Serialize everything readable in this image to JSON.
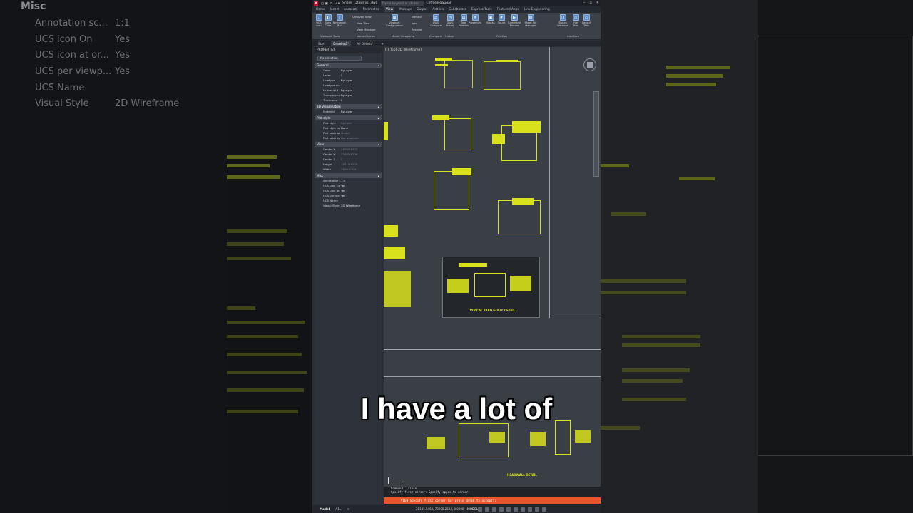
{
  "background_left": {
    "heading": "Misc",
    "rows": [
      {
        "key": "Annotation sc...",
        "value": "1:1"
      },
      {
        "key": "UCS icon On",
        "value": "Yes"
      },
      {
        "key": "UCS icon at or...",
        "value": "Yes"
      },
      {
        "key": "UCS per viewp...",
        "value": "Yes"
      },
      {
        "key": "UCS Name",
        "value": ""
      },
      {
        "key": "Visual Style",
        "value": "2D Wireframe"
      }
    ]
  },
  "titlebar": {
    "share": "Share",
    "file": "Drawing1.dwg",
    "search_placeholder": "Type a keyword or phrase",
    "user": "CoffeeTeaSugar"
  },
  "ribbon_tabs": [
    "Home",
    "Insert",
    "Annotate",
    "Parametric",
    "View",
    "Manage",
    "Output",
    "Add-ins",
    "Collaborate",
    "Express Tools",
    "Featured Apps",
    "Link Engineering"
  ],
  "active_ribbon_tab": "View",
  "ribbon": {
    "buttons": [
      {
        "label": "UCS\nIcon",
        "icon": "ucs-icon"
      },
      {
        "label": "View\nCube",
        "icon": "viewcube-icon"
      },
      {
        "label": "Navigation\nBar",
        "icon": "navbar-icon"
      },
      {
        "label": "Viewport\nConfiguration",
        "icon": "viewport-icon"
      },
      {
        "label": "DWG\nCompare",
        "icon": "compare-icon"
      },
      {
        "label": "DWG\nHistory",
        "icon": "history-icon"
      },
      {
        "label": "Tool\nPalettes",
        "icon": "palette-icon"
      },
      {
        "label": "Properties",
        "icon": "properties-icon"
      },
      {
        "label": "Blocks",
        "icon": "blocks-icon"
      },
      {
        "label": "Count",
        "icon": "count-icon"
      },
      {
        "label": "Command\nMacros",
        "icon": "macro-icon"
      },
      {
        "label": "Sheet Set\nManager",
        "icon": "sheetset-icon"
      },
      {
        "label": "Switch\nWindows",
        "icon": "windows-icon"
      },
      {
        "label": "File\nTabs",
        "icon": "filetabs-icon"
      },
      {
        "label": "Layout\nTabs",
        "icon": "layouttabs-icon"
      }
    ],
    "small_items": [
      "Unsaved View",
      "New View",
      "View Manager",
      "Named",
      "Join",
      "Restore"
    ],
    "groups": [
      "Viewport Tools",
      "Named Views",
      "Model Viewports",
      "Compare",
      "History",
      "Palettes",
      "Interface"
    ]
  },
  "doc_tabs": [
    "Start",
    "Drawing1*",
    "All Details*",
    "+"
  ],
  "active_doc_tab": "Drawing1*",
  "properties": {
    "title": "PROPERTIES",
    "selection": "No selection",
    "sections": [
      {
        "name": "General",
        "rows": [
          {
            "k": "Color",
            "v": "ByLayer"
          },
          {
            "k": "Layer",
            "v": "0"
          },
          {
            "k": "Linetype",
            "v": "ByLayer"
          },
          {
            "k": "Linetype scale",
            "v": "1"
          },
          {
            "k": "Lineweight",
            "v": "ByLayer"
          },
          {
            "k": "Transparency",
            "v": "ByLayer"
          },
          {
            "k": "Thickness",
            "v": "0"
          }
        ]
      },
      {
        "name": "3D Visualization",
        "rows": [
          {
            "k": "Material",
            "v": "ByLayer"
          }
        ]
      },
      {
        "name": "Plot style",
        "rows": [
          {
            "k": "Plot style",
            "v": "ByColor"
          },
          {
            "k": "Plot style table",
            "v": "None"
          },
          {
            "k": "Plot table atta...",
            "v": "Model"
          },
          {
            "k": "Plot table type",
            "v": "Not available"
          }
        ]
      },
      {
        "name": "View",
        "rows": [
          {
            "k": "Center X",
            "v": "28765.8972"
          },
          {
            "k": "Center Y",
            "v": "75055.8756"
          },
          {
            "k": "Center Z",
            "v": "0"
          },
          {
            "k": "Height",
            "v": "16719.8578"
          },
          {
            "k": "Width",
            "v": "7856.8708"
          }
        ]
      },
      {
        "name": "Misc",
        "rows": [
          {
            "k": "Annotation sc...",
            "v": "1:1"
          },
          {
            "k": "UCS icon On",
            "v": "Yes"
          },
          {
            "k": "UCS icon at or...",
            "v": "Yes"
          },
          {
            "k": "UCS per viewp...",
            "v": "Yes"
          },
          {
            "k": "UCS Name",
            "v": ""
          },
          {
            "k": "Visual Style",
            "v": "2D Wireframe"
          }
        ]
      }
    ]
  },
  "viewport_label": "[-][Top][2D Wireframe]",
  "drawing_titles": {
    "gully": "TYPICAL YARD GULLY DETAIL",
    "headwall": "HEADWALL DETAIL"
  },
  "command": {
    "history_1": "Command: _close",
    "history_2": "Specify first corner: Specify opposite corner:",
    "prompt": "VIEW Specify first corner [or press ENTER to accept]:"
  },
  "status": {
    "tabs": [
      "Model",
      "A1L",
      "+"
    ],
    "active_tab": "Model",
    "coords": "28181.5468, 70208.2534, 0.0000",
    "mode": "MODEL"
  },
  "subtitle": "I have a lot of",
  "colors": {
    "accent_yellow": "#d8e11b",
    "prompt_orange": "#e8542b",
    "autocad_red": "#c8102e"
  }
}
